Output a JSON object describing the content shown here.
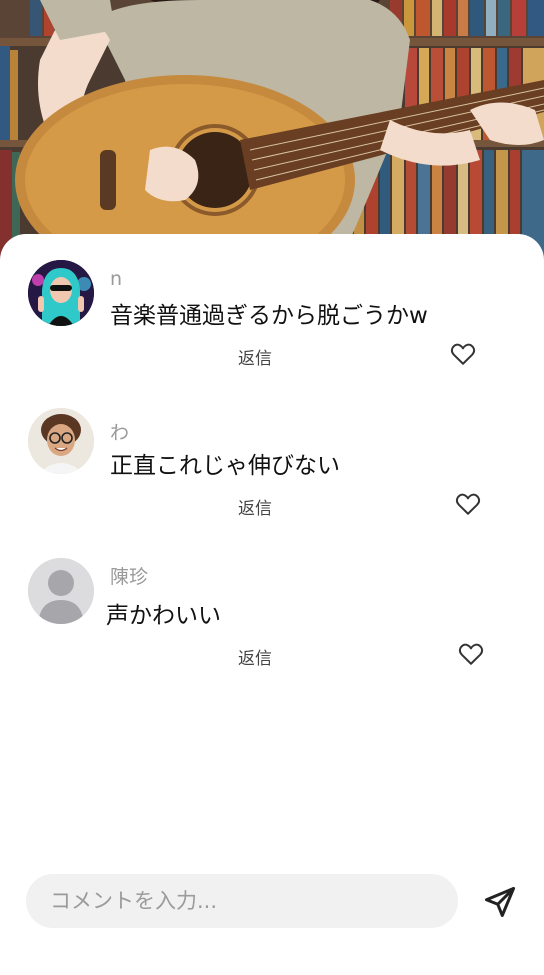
{
  "video": {
    "scene": "acoustic-guitar-player"
  },
  "comments": [
    {
      "username": "n",
      "text": "音楽普通過ぎるから脱ごうかw",
      "reply_label": "返信",
      "avatar": "avatar-teal-hair-neon",
      "like_icon": "heart-outline-icon"
    },
    {
      "username": "わ",
      "text": "正直これじゃ伸びない",
      "reply_label": "返信",
      "avatar": "avatar-curly-hair-glasses",
      "like_icon": "heart-outline-icon"
    },
    {
      "username": "陳珍",
      "text": "声かわいい",
      "reply_label": "返信",
      "avatar": "avatar-default-silhouette",
      "like_icon": "heart-outline-icon"
    }
  ],
  "composer": {
    "placeholder": "コメントを入力...",
    "value": "",
    "send_icon": "send-icon"
  },
  "colors": {
    "sheet_bg": "#ffffff",
    "username": "#9a9a9a",
    "text": "#111111",
    "input_bg": "#f1f1f1"
  }
}
